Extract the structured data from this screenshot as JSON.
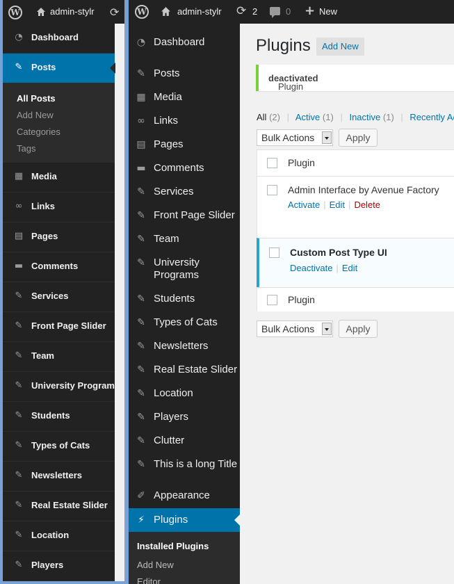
{
  "left_panel": {
    "site_name": "admin-stylr",
    "menu": [
      {
        "label": "Dashboard",
        "icon": "dashboard-icon"
      },
      {
        "label": "Posts",
        "icon": "pushpin-icon",
        "active": true
      },
      {
        "label": "Media",
        "icon": "media-icon"
      },
      {
        "label": "Links",
        "icon": "link-icon"
      },
      {
        "label": "Pages",
        "icon": "pages-icon"
      },
      {
        "label": "Comments",
        "icon": "comment-icon"
      },
      {
        "label": "Services",
        "icon": "pushpin-icon"
      },
      {
        "label": "Front Page Slider",
        "icon": "pushpin-icon"
      },
      {
        "label": "Team",
        "icon": "pushpin-icon"
      },
      {
        "label": "University Programs",
        "icon": "pushpin-icon"
      },
      {
        "label": "Students",
        "icon": "pushpin-icon"
      },
      {
        "label": "Types of Cats",
        "icon": "pushpin-icon"
      },
      {
        "label": "Newsletters",
        "icon": "pushpin-icon"
      },
      {
        "label": "Real Estate Slider",
        "icon": "pushpin-icon"
      },
      {
        "label": "Location",
        "icon": "pushpin-icon"
      },
      {
        "label": "Players",
        "icon": "pushpin-icon"
      }
    ],
    "posts_submenu": [
      "All Posts",
      "Add New",
      "Categories",
      "Tags"
    ]
  },
  "topbar": {
    "site_name": "admin-stylr",
    "updates_count": "2",
    "comments_count": "0",
    "new_label": "New"
  },
  "sidebar": {
    "items": [
      {
        "label": "Dashboard",
        "icon": "dashboard-icon"
      },
      {
        "label": "Posts",
        "icon": "pushpin-icon"
      },
      {
        "label": "Media",
        "icon": "media-icon"
      },
      {
        "label": "Links",
        "icon": "link-icon"
      },
      {
        "label": "Pages",
        "icon": "pages-icon"
      },
      {
        "label": "Comments",
        "icon": "comment-icon"
      },
      {
        "label": "Services",
        "icon": "pushpin-icon"
      },
      {
        "label": "Front Page Slider",
        "icon": "pushpin-icon"
      },
      {
        "label": "Team",
        "icon": "pushpin-icon"
      },
      {
        "label": "University Programs",
        "icon": "pushpin-icon"
      },
      {
        "label": "Students",
        "icon": "pushpin-icon"
      },
      {
        "label": "Types of Cats",
        "icon": "pushpin-icon"
      },
      {
        "label": "Newsletters",
        "icon": "pushpin-icon"
      },
      {
        "label": "Real Estate Slider",
        "icon": "pushpin-icon"
      },
      {
        "label": "Location",
        "icon": "pushpin-icon"
      },
      {
        "label": "Players",
        "icon": "pushpin-icon"
      },
      {
        "label": "Clutter",
        "icon": "pushpin-icon"
      },
      {
        "label": "This is a long Title",
        "icon": "pushpin-icon"
      },
      {
        "label": "Appearance",
        "icon": "appearance-icon"
      },
      {
        "label": "Plugins",
        "icon": "plugins-icon",
        "active": true
      }
    ],
    "submenu": [
      "Installed Plugins",
      "Add New",
      "Editor"
    ]
  },
  "page": {
    "title": "Plugins",
    "add_new": "Add New",
    "notice_prefix": "Plugin ",
    "notice_bold": "deactivated",
    "notice_suffix": "."
  },
  "filters": {
    "all": "All",
    "all_count": "(2)",
    "active": "Active",
    "active_count": "(1)",
    "inactive": "Inactive",
    "inactive_count": "(1)",
    "recent": "Recently Active"
  },
  "bulk": {
    "label": "Bulk Actions",
    "apply": "Apply"
  },
  "table": {
    "header": "Plugin",
    "footer": "Plugin",
    "rows": [
      {
        "name": "Admin Interface by Avenue Factory",
        "actions": [
          "Activate",
          "Edit",
          "Delete"
        ]
      },
      {
        "name": "Custom Post Type UI",
        "actions": [
          "Deactivate",
          "Edit"
        ]
      }
    ]
  },
  "colors": {
    "accent": "#0073aa",
    "notice": "#7ad03a",
    "active_plugin": "#2ea2cc",
    "sidebar": "#222222"
  }
}
